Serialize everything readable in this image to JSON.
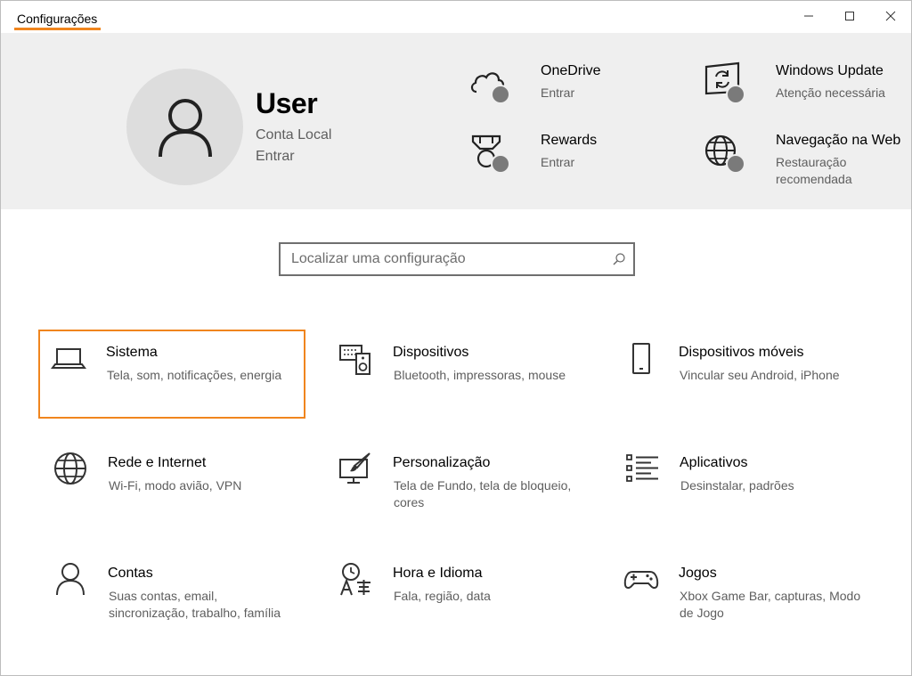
{
  "window": {
    "title": "Configurações",
    "accent_color": "#f0851e",
    "controls": {
      "minimize_icon": "minimize-icon",
      "maximize_icon": "maximize-icon",
      "close_icon": "close-icon"
    }
  },
  "account": {
    "name": "User",
    "type": "Conta Local",
    "sign_in": "Entrar",
    "avatar_icon": "person-icon"
  },
  "header_items": [
    {
      "icon": "cloud-icon",
      "title": "OneDrive",
      "subtitle": "Entrar"
    },
    {
      "icon": "windows-update-icon",
      "title": "Windows Update",
      "subtitle": "Atenção necessária"
    },
    {
      "icon": "medal-icon",
      "title": "Rewards",
      "subtitle": "Entrar"
    },
    {
      "icon": "globe-icon",
      "title": "Navegação na Web",
      "subtitle_line1": "Restauração",
      "subtitle_line2": "recomendada"
    }
  ],
  "search": {
    "placeholder": "Localizar uma configuração",
    "value": "",
    "icon": "search-icon"
  },
  "categories": [
    {
      "icon": "laptop-icon",
      "title": "Sistema",
      "subtitle": "Tela, som, notificações, energia",
      "selected": true
    },
    {
      "icon": "devices-icon",
      "title": "Dispositivos",
      "subtitle": "Bluetooth, impressoras, mouse"
    },
    {
      "icon": "phone-icon",
      "title": "Dispositivos móveis",
      "subtitle": "Vincular seu Android, iPhone"
    },
    {
      "icon": "globe-icon",
      "title": "Rede e Internet",
      "subtitle": "Wi-Fi, modo avião, VPN"
    },
    {
      "icon": "paintbrush-icon",
      "title": "Personalização",
      "subtitle_line1": "Tela de Fundo, tela de bloqueio,",
      "subtitle_line2": "cores"
    },
    {
      "icon": "apps-list-icon",
      "title": "Aplicativos",
      "subtitle": "Desinstalar, padrões"
    },
    {
      "icon": "person-icon",
      "title": "Contas",
      "subtitle_line1": "Suas contas, email,",
      "subtitle_line2": "sincronização, trabalho, família"
    },
    {
      "icon": "time-language-icon",
      "title": "Hora e Idioma",
      "subtitle": "Fala, região, data"
    },
    {
      "icon": "gamepad-icon",
      "title": "Jogos",
      "subtitle_line1": "Xbox Game Bar, capturas, Modo",
      "subtitle_line2": "de Jogo"
    }
  ]
}
